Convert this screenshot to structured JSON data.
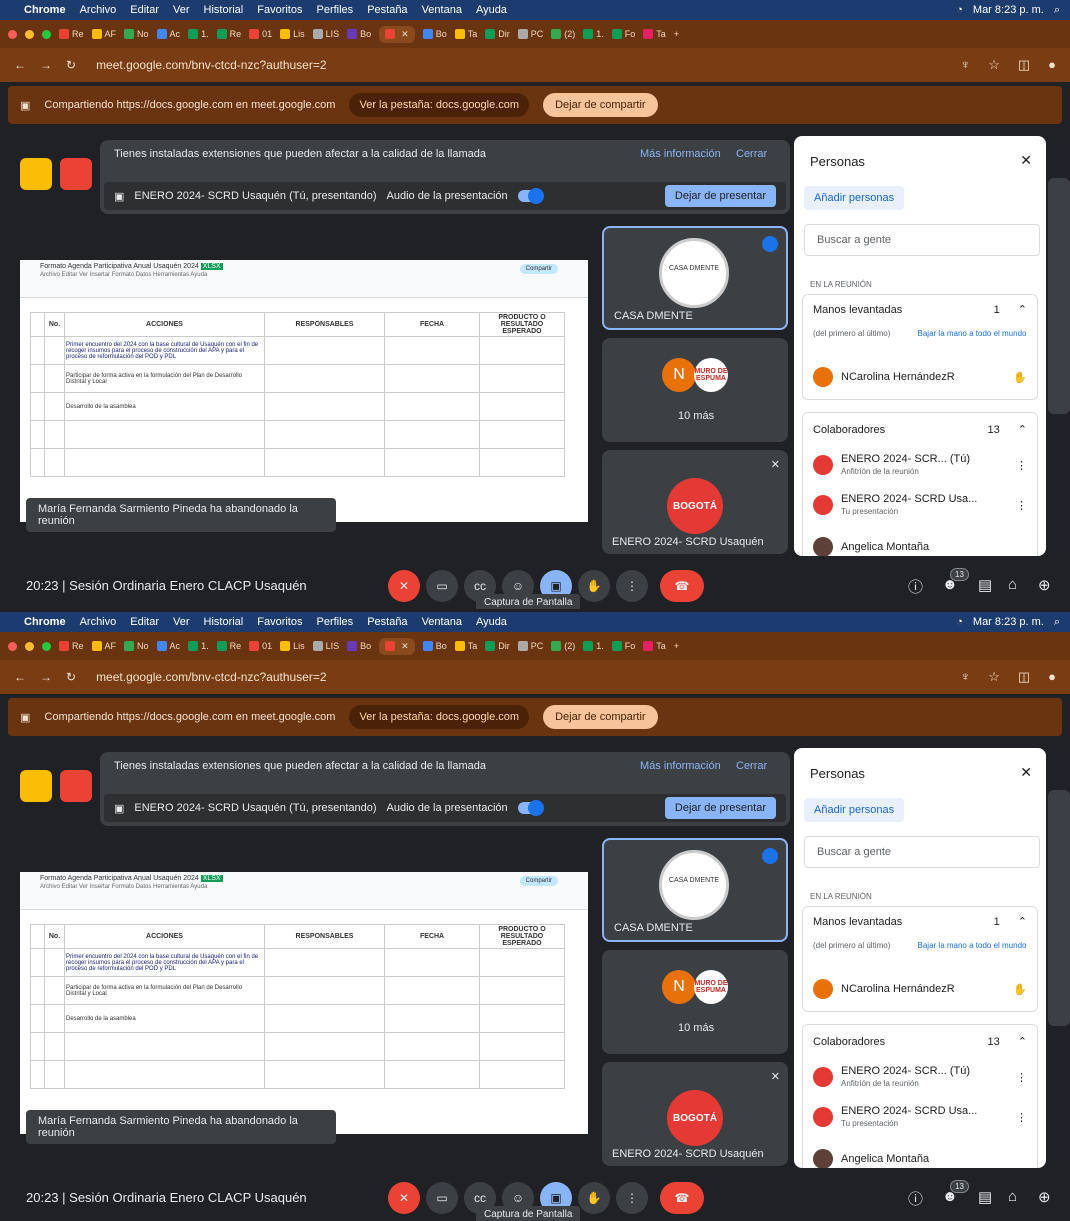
{
  "menubar": {
    "apple": "",
    "items": [
      "Chrome",
      "Archivo",
      "Editar",
      "Ver",
      "Historial",
      "Favoritos",
      "Perfiles",
      "Pestaña",
      "Ventana",
      "Ayuda"
    ],
    "clock": "Mar 8:23 p. m."
  },
  "tabs": [
    "Re",
    "AF",
    "No",
    "Ac",
    "1.",
    "Re",
    "01",
    "Lis",
    "LIS",
    "Bo",
    "",
    "Bo",
    "Ta",
    "Dir",
    "PC",
    "(2)",
    "1.",
    "Fo",
    "Ta"
  ],
  "browser": {
    "url": "meet.google.com/bnv-ctcd-nzc?authuser=2"
  },
  "sharing": {
    "text": "Compartiendo https://docs.google.com en meet.google.com",
    "goto_label": "Ver la pestaña: docs.google.com",
    "stop_label": "Dejar de compartir"
  },
  "notice": {
    "text": "Tienes instaladas extensiones que pueden afectar a la calidad de la llamada",
    "more_info": "Más información",
    "close": "Cerrar",
    "presenting": "ENERO 2024- SCRD Usaquén (Tú, presentando)",
    "audio": "Audio de la presentación",
    "stop_presenting": "Dejar de presentar"
  },
  "sheet": {
    "title": "Formato Agenda Participativa Anual Usaquén 2024",
    "badge": "XLSX",
    "menu": "Archivo  Editar  Ver  Insertar  Formato  Datos  Herramientas  Ayuda",
    "share": "Compartir",
    "headers": [
      "No.",
      "ACCIONES",
      "RESPONSABLES",
      "FECHA",
      "PRODUCTO O RESULTADO ESPERADO"
    ],
    "rows": [
      "Primer encuentro del 2024 con la base cultural de Usaquén con el fin de recoger insumos para el proceso de construcción del APA y para el proceso de reformulación del POD y PDL",
      "Participar de forma activa en la formulación del Plan de Desarrollo Distrital y Local",
      "Desarrollo de la asamblea"
    ]
  },
  "toast": "María Fernanda Sarmiento Pineda ha abandonado la reunión",
  "tiles": {
    "casa": "CASA DMENTE",
    "casa_logo": "CASA DMENTE",
    "more": "10 más",
    "avatar_letter": "N",
    "muro": "MURO DE ESPUMA",
    "bogota_logo": "BOGOTÁ",
    "bogota": "ENERO 2024- SCRD Usaquén"
  },
  "people": {
    "title": "Personas",
    "add": "Añadir personas",
    "search": "Buscar a gente",
    "section": "EN LA REUNIÓN",
    "raised": "Manos levantadas",
    "raised_count": "1",
    "order": "(del primero al último)",
    "lower_all": "Bajar la mano a todo el mundo",
    "raised_person": "NCarolina HernándezR",
    "collab": "Colaboradores",
    "collab_count": "13",
    "p1": "ENERO 2024- SCR...",
    "p1_you": "(Tú)",
    "p1_role": "Anfitrión de la reunión",
    "p2": "ENERO 2024- SCRD Usa...",
    "p2_role": "Tu presentación",
    "p3": "Angelica Montaña"
  },
  "control": {
    "time": "20:23",
    "meeting": "Sesión Ordinaria Enero CLACP Usaquén",
    "tooltip": "Captura de Pantalla",
    "people_count": "13"
  }
}
